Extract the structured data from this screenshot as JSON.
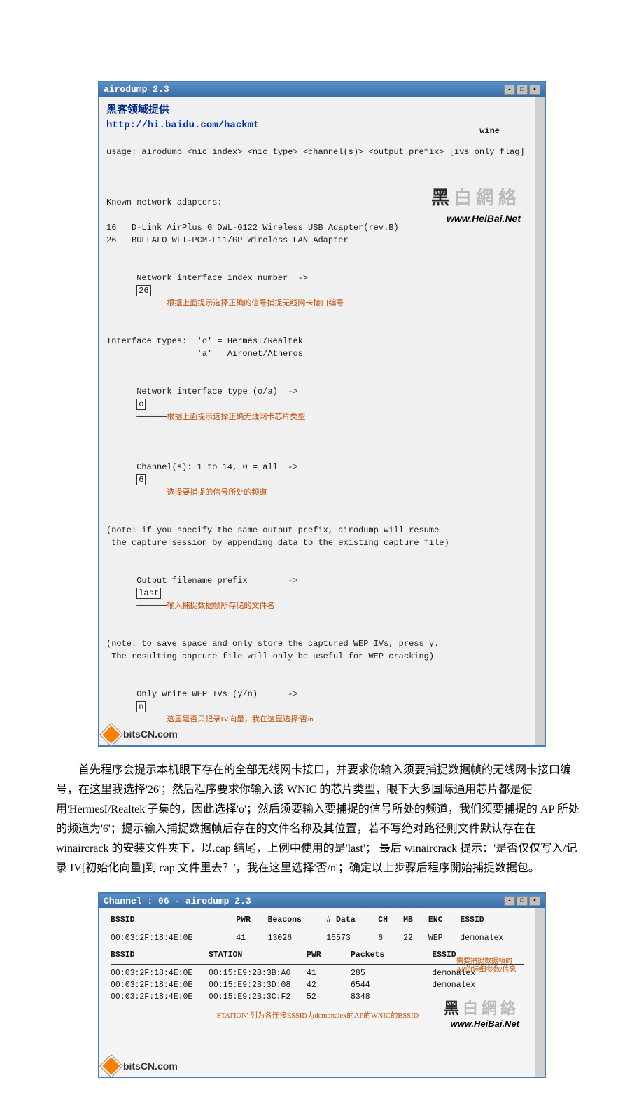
{
  "screenshot1": {
    "title": "airodump 2.3",
    "header_cn": "黑客领域提供",
    "header_url": "http://hi.baidu.com/hackmt",
    "right_label": "wine",
    "usage": "usage: airodump <nic index> <nic type> <channel(s)> <output prefix> [ivs only flag]",
    "known_adapters_label": "Known network adapters:",
    "adapters": [
      "16   D-Link AirPlus G DWL-G122 Wireless USB Adapter(rev.B)",
      "26   BUFFALO WLI-PCM-L11/GP Wireless LAN Adapter"
    ],
    "nic_index_label": "Network interface index number  ->",
    "nic_index_value": "26",
    "nic_index_annot": "根据上面提示选择正确的信号捕捉无线网卡接口编号",
    "iface_types": "Interface types:  'o' = HermesI/Realtek\n                  'a' = Aironet/Atheros",
    "nic_type_label": "Network interface type (o/a)  ->",
    "nic_type_value": "o",
    "nic_type_annot": "根据上面提示选择正确无线网卡芯片类型",
    "channel_label": "Channel(s): 1 to 14, 0 = all  ->",
    "channel_value": "6",
    "channel_annot": "选择要捕捉的信号所处的频道",
    "note1": "(note: if you specify the same output prefix, airodump will resume\n the capture session by appending data to the existing capture file)",
    "out_label": "Output filename prefix        ->",
    "out_value": "last",
    "out_annot": "输入捕捉数据帧所存储的文件名",
    "note2": "(note: to save space and only store the captured WEP IVs, press y.\n The resulting capture file will only be useful for WEP cracking)",
    "ivs_label": "Only write WEP IVs (y/n)      ->",
    "ivs_value": "n",
    "ivs_annot": "这里是否只记录IV向量，我在这里选择'否/n'",
    "watermark_logo_a": "黑",
    "watermark_logo_b": "白網絡",
    "watermark_url": "www.HeiBai.Net",
    "footer": "bitsCN.com"
  },
  "paragraph": "首先程序会提示本机眼下存在的全部无线网卡接口，并要求你输入须要捕捉数据帧的无线网卡接口编号，在这里我选择'26'；然后程序要求你输入该 WNIC 的芯片类型，眼下大多国际通用芯片都是使用'HermesI/Realtek'子集的，因此选择'o'；然后须要输入要捕捉的信号所处的频道，我们须要捕捉的 AP 所处的频道为'6'；提示输入捕捉数据帧后存在的文件名称及其位置，若不写绝对路径则文件默认存在在 winaircrack 的安装文件夹下，以.cap 结尾，上例中使用的是'last'； 最后 winaircrack 提示：'是否仅仅写入/记录 IV[初始化向量]到 cap 文件里去？'，我在这里选择'否/n'；确定以上步骤后程序開始捕捉数据包。",
  "screenshot2": {
    "title": "Channel : 06 - airodump 2.3",
    "headers1": [
      "BSSID",
      "PWR",
      "Beacons",
      "# Data",
      "CH",
      "MB",
      "ENC",
      "ESSID"
    ],
    "row1": [
      "00:03:2F:18:4E:0E",
      "41",
      "13026",
      "15573",
      "6",
      "22",
      "WEP",
      "demonalex"
    ],
    "headers2": [
      "BSSID",
      "STATION",
      "PWR",
      "Packets",
      "ESSID"
    ],
    "rows2": [
      [
        "00:03:2F:18:4E:0E",
        "00:15:E9:2B:3B:A6",
        "41",
        "285",
        "demonalex"
      ],
      [
        "00:03:2F:18:4E:0E",
        "00:15:E9:2B:3D:08",
        "42",
        "6544",
        "demonalex"
      ],
      [
        "00:03:2F:18:4E:0E",
        "00:15:E9:2B:3C:F2",
        "52",
        "8348",
        ""
      ]
    ],
    "red_annot": "需要捕捉数据帧的AP的详细参数/信息",
    "note": "'STATION' 列为各连接ESSID为demonalex的AP的WNIC的BSSID",
    "watermark_logo_a": "黑",
    "watermark_logo_b": "白網絡",
    "watermark_url": "www.HeiBai.Net",
    "footer": "bitsCN.com"
  }
}
